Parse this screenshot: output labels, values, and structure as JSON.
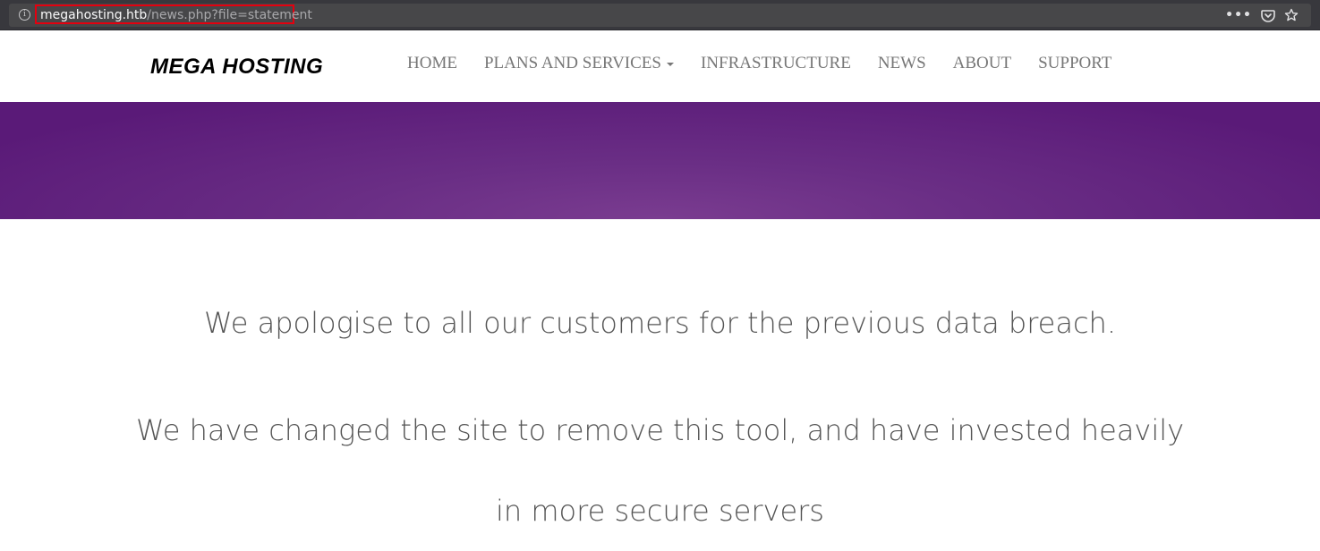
{
  "browser": {
    "url_domain": "megahosting.htb",
    "url_path": "/news.php?file=statement",
    "page_actions_icon": "more-dots-icon",
    "pocket_icon": "pocket-icon",
    "bookmark_icon": "star-icon"
  },
  "site": {
    "brand": "MEGA HOSTING",
    "nav": [
      {
        "label": "HOME"
      },
      {
        "label": "PLANS AND SERVICES"
      },
      {
        "label": "INFRASTRUCTURE"
      },
      {
        "label": "NEWS"
      },
      {
        "label": "ABOUT"
      },
      {
        "label": "SUPPORT"
      }
    ]
  },
  "statement": {
    "line1": "We apologise to all our customers for the previous data breach.",
    "line2": "We have changed the site to remove this tool, and have invested heavily",
    "line3": "in more secure servers"
  },
  "colors": {
    "banner": "#5a1a78",
    "url_highlight": "#e4000f"
  }
}
